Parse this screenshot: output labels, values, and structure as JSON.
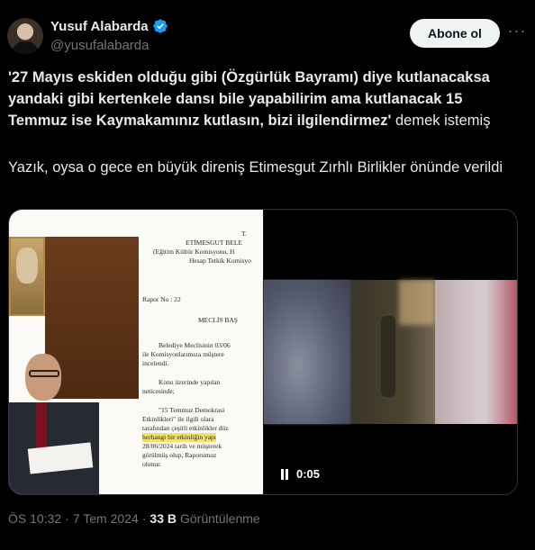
{
  "author": {
    "name": "Yusuf Alabarda",
    "handle": "@yusufalabarda"
  },
  "actions": {
    "follow_label": "Abone ol",
    "more_glyph": "···"
  },
  "tweet": {
    "bold_quote": "'27 Mayıs eskiden olduğu gibi (Özgürlük Bayramı) diye kutlanacaksa yandaki gibi kertenkele dansı bile yapabilirim ama kutlanacak 15 Temmuz ise Kaymakamınız kutlasın, bizi ilgilendirmez'",
    "quote_tail": " demek istemiş",
    "paragraph2": "Yazık, oysa o gece en büyük direniş Etimesgut Zırhlı Birlikler önünde verildi"
  },
  "document": {
    "lines": [
      "T.",
      "ETİMESGUT BELE",
      "(Eğitim Kültür Komisyonu, H",
      "Hesap Tetkik Komisyo",
      "Rapor No : 22",
      "MECLİS BAŞ",
      "Belediye Meclisinin 03/06",
      "ile Komisyonlarımıza müştere",
      "incelendi.",
      "Konu üzerinde yapılan",
      "neticesinde;",
      "\"15 Temmuz Demokrasi",
      "Etkinlikleri\" ile ilgili olara",
      "tarafından çeşitli etkinlikler düz",
      "herhangi bir etkinliğin yapı",
      "28/06/2024 tarih ve müşterek",
      "görülmüş olup, Raporumuz",
      "olunur."
    ]
  },
  "video": {
    "time": "0:05"
  },
  "meta": {
    "time": "ÖS 10:32",
    "dot": "·",
    "date": "7 Tem 2024",
    "views_count": "33 B",
    "views_label": "Görüntülenme"
  },
  "colors": {
    "background": "#000000",
    "text": "#e7e9ea",
    "muted": "#71767b",
    "verified": "#1d9bf0"
  }
}
